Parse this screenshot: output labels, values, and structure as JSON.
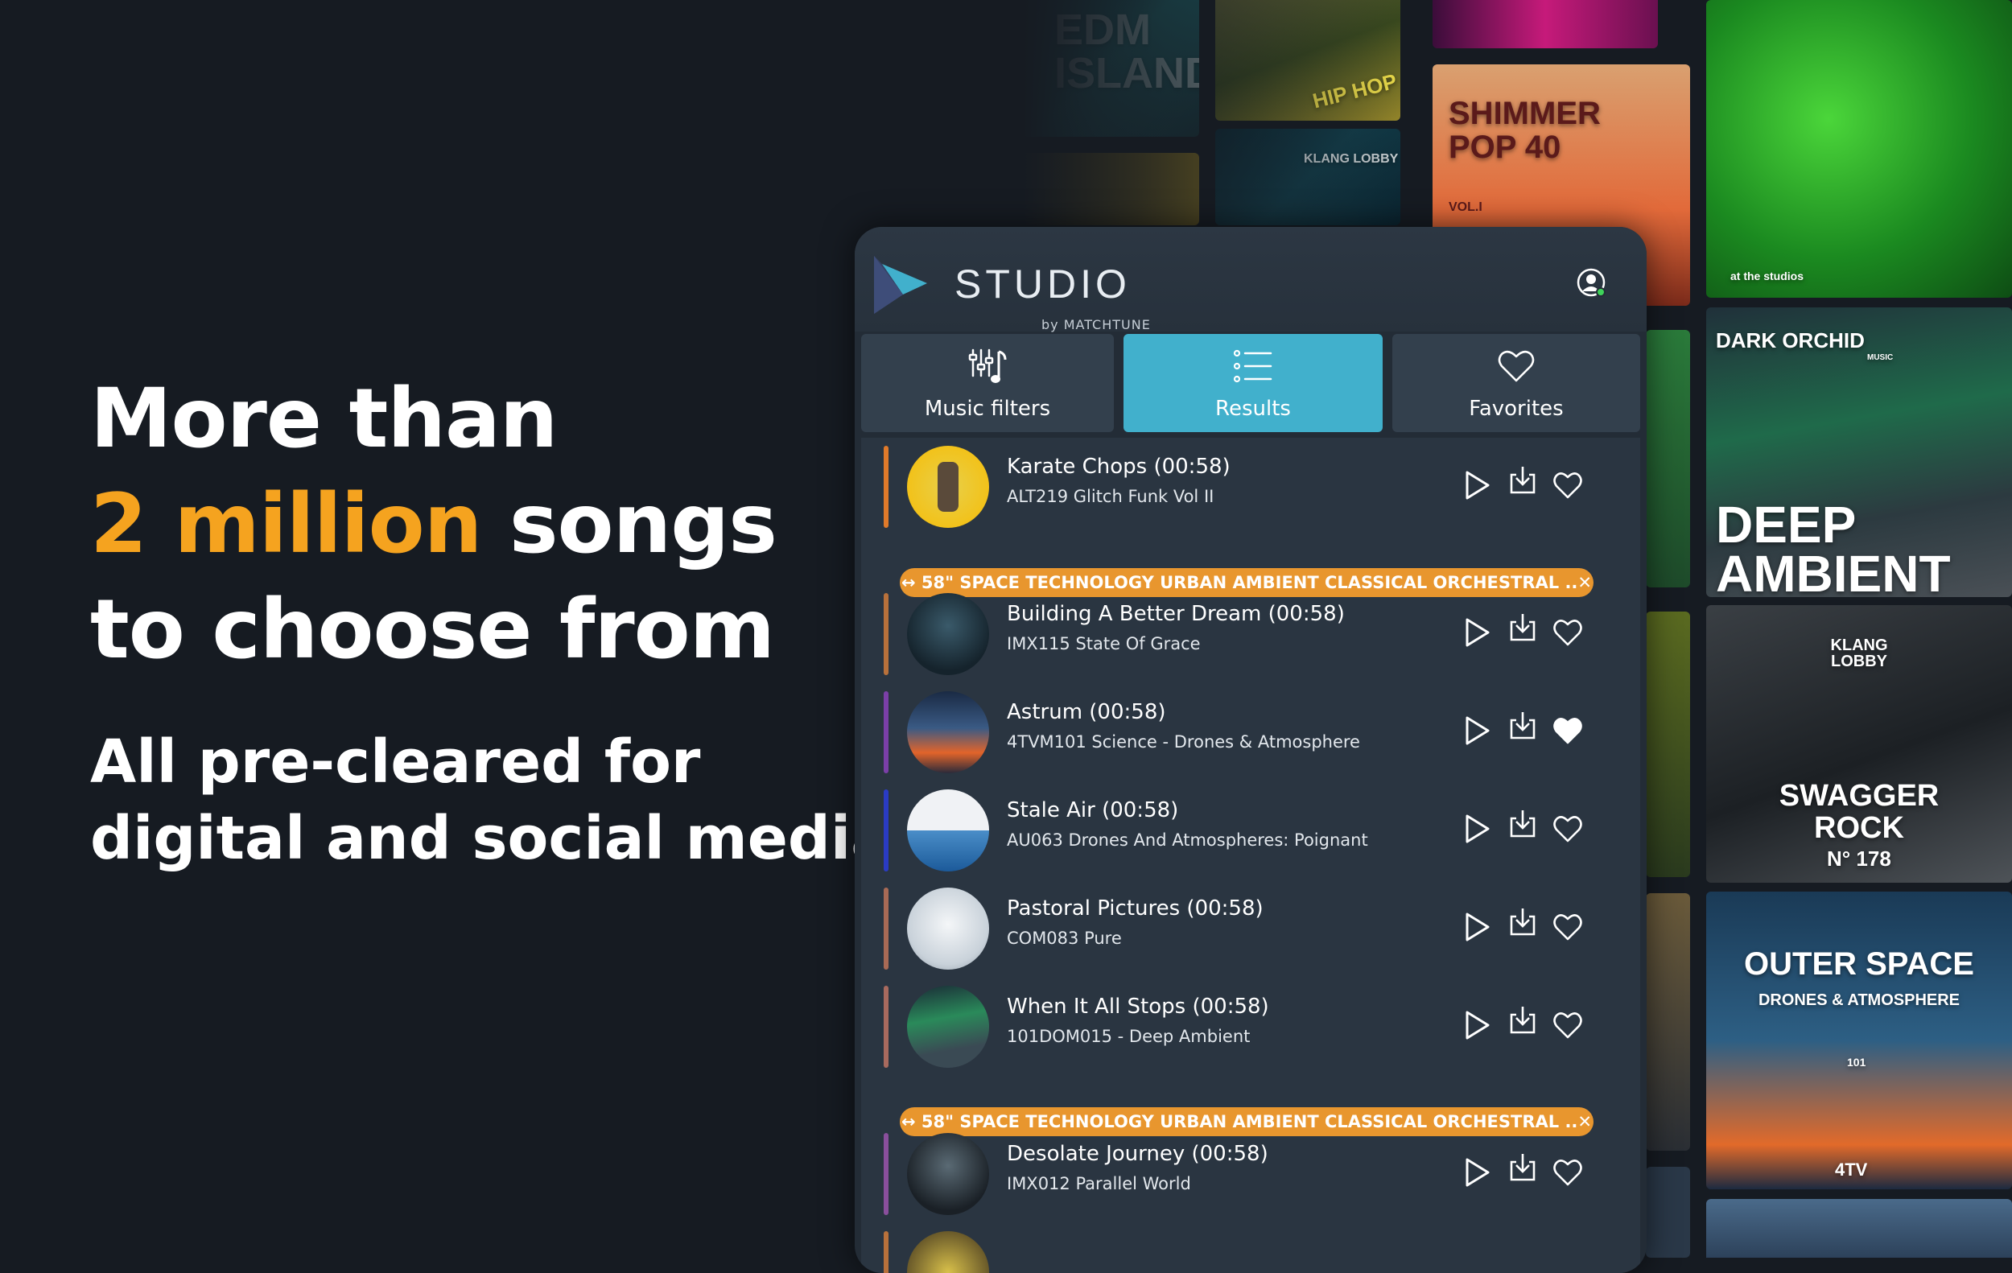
{
  "hero": {
    "line1": "More than",
    "highlight": "2 million",
    "line2_rest": " songs",
    "line3": "to choose from",
    "sub1": "All pre-cleared for",
    "sub2": "digital and social media",
    "highlight_color": "#f5a31f"
  },
  "wall": {
    "tiles": [
      "EDM Island",
      "HIP HOP",
      "SHIMMER POP 40",
      "VOL.I",
      "KLANG LOBBY",
      "at the studios",
      "DARK ORCHID",
      "MUSIC",
      "DEEP AMBIENT",
      "KLANG LOBBY",
      "SWAGGER ROCK",
      "N° 178",
      "OUTER SPACE",
      "DRONES & ATMOSPHERE",
      "101",
      "4TV"
    ]
  },
  "app": {
    "logo_word": "STUDIO",
    "logo_sub": "by MATCHTUNE",
    "accent": "#41b0cc",
    "tabs": [
      {
        "label": "Music filters",
        "icon": "music-filters-icon",
        "active": false
      },
      {
        "label": "Results",
        "icon": "list-icon",
        "active": true
      },
      {
        "label": "Favorites",
        "icon": "heart-icon",
        "active": false
      }
    ],
    "banner_text": "↔ 58\" SPACE TECHNOLOGY URBAN AMBIENT CLASSICAL ORCHESTRAL ..✕",
    "tracks": [
      {
        "title": "Karate Chops (00:58)",
        "album": "ALT219 Glitch Funk Vol II",
        "bar_color": "#e07a2a",
        "favorite": false
      },
      {
        "title": "Building A Better Dream (00:58)",
        "album": "IMX115 State Of Grace",
        "bar_color": "#b8713b",
        "favorite": false
      },
      {
        "title": "Astrum (00:58)",
        "album": "4TVM101 Science - Drones & Atmosphere",
        "bar_color": "#7b3fa8",
        "favorite": true
      },
      {
        "title": "Stale Air (00:58)",
        "album": "AU063 Drones And Atmospheres: Poignant",
        "bar_color": "#2a3bc4",
        "favorite": false
      },
      {
        "title": "Pastoral Pictures (00:58)",
        "album": "COM083 Pure",
        "bar_color": "#a86a55",
        "favorite": false
      },
      {
        "title": "When It All Stops (00:58)",
        "album": "101DOM015 - Deep Ambient",
        "bar_color": "#a86a5e",
        "favorite": false
      },
      {
        "title": "Desolate Journey (00:58)",
        "album": "IMX012 Parallel World",
        "bar_color": "#8a4f9c",
        "favorite": false
      }
    ]
  }
}
